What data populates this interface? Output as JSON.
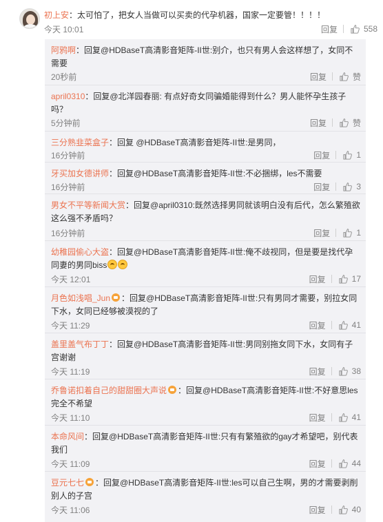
{
  "top_comment": {
    "author": "初上安",
    "text": "：太可怕了，把女人当做可以买卖的代孕机器，国家一定要管！！！！",
    "time": "今天 10:01",
    "reply_label": "回复",
    "likes": "558"
  },
  "replies": [
    {
      "author": "阿鸦啊",
      "text": "：回复@HDBaseT高清影音矩阵-II世:别介，也只有男人会这样想了，女同不需要",
      "time": "20秒前",
      "reply_label": "回复",
      "likes": "赞"
    },
    {
      "author": "april0310",
      "text": "：回复@北洋园春丽: 有点好奇女同骗婚能得到什么？男人能怀孕生孩子吗？",
      "time": "5分钟前",
      "reply_label": "回复",
      "likes": "赞"
    },
    {
      "author": "三分熟韭菜盒子",
      "text": "：回复 @HDBaseT高清影音矩阵-II世:是男同，",
      "time": "16分钟前",
      "reply_label": "回复",
      "likes": "1"
    },
    {
      "author": "牙买加女德讲师",
      "text": "：回复@HDBaseT高清影音矩阵-II世:不必捆绑，les不需要",
      "time": "16分钟前",
      "reply_label": "回复",
      "likes": "3"
    },
    {
      "author": "男女不平等新闻大赏",
      "text": "：回复@april0310:既然选择男同就该明白没有后代，怎么繁殖欲这么强不矛盾吗？",
      "time": "16分钟前",
      "reply_label": "回复",
      "likes": "1"
    },
    {
      "author": "幼稚园偷心大盗",
      "text": "：回复@HDBaseT高清影音矩阵-II世:俺不歧视同，但是要是找代孕同妻的男同biss",
      "time": "今天 12:01",
      "reply_label": "回复",
      "likes": "17"
    },
    {
      "author": "月色如浅唱_Jun",
      "text": "：回复@HDBaseT高清影音矩阵-II世:只有男同才需要，别拉女同下水，女同已经够被漠视的了",
      "time": "今天 11:29",
      "reply_label": "回复",
      "likes": "41"
    },
    {
      "author": "盖里盖气布丁丁",
      "text": "：回复@HDBaseT高清影音矩阵-II世:男同别拖女同下水，女同有子宫谢谢",
      "time": "今天 11:19",
      "reply_label": "回复",
      "likes": "38"
    },
    {
      "author": "乔鲁诺扣着自己的甜甜圈大声说",
      "text": "：回复@HDBaseT高清影音矩阵-II世:不好意思les完全不希望",
      "time": "今天 11:10",
      "reply_label": "回复",
      "likes": "41"
    },
    {
      "author": "本命风间",
      "text": "：回复@HDBaseT高清影音矩阵-II世:只有有繁殖欲的gay才希望吧，别代表我们",
      "time": "今天 11:09",
      "reply_label": "回复",
      "likes": "44"
    },
    {
      "author": "豆元七七",
      "text": "：回复@HDBaseT高清影音矩阵-II世:les可以自己生啊，男的才需要剥削别人的子宫",
      "time": "今天 11:06",
      "reply_label": "回复",
      "likes": "40"
    }
  ],
  "colors": {
    "username": "#eb7350",
    "reply_bg": "#f2f2f5",
    "meta": "#808080"
  },
  "icons": {
    "like": "thumbs-up-icon",
    "avatar": "user-avatar",
    "emoji": "laughing-emoji",
    "badge": "vip-badge"
  }
}
